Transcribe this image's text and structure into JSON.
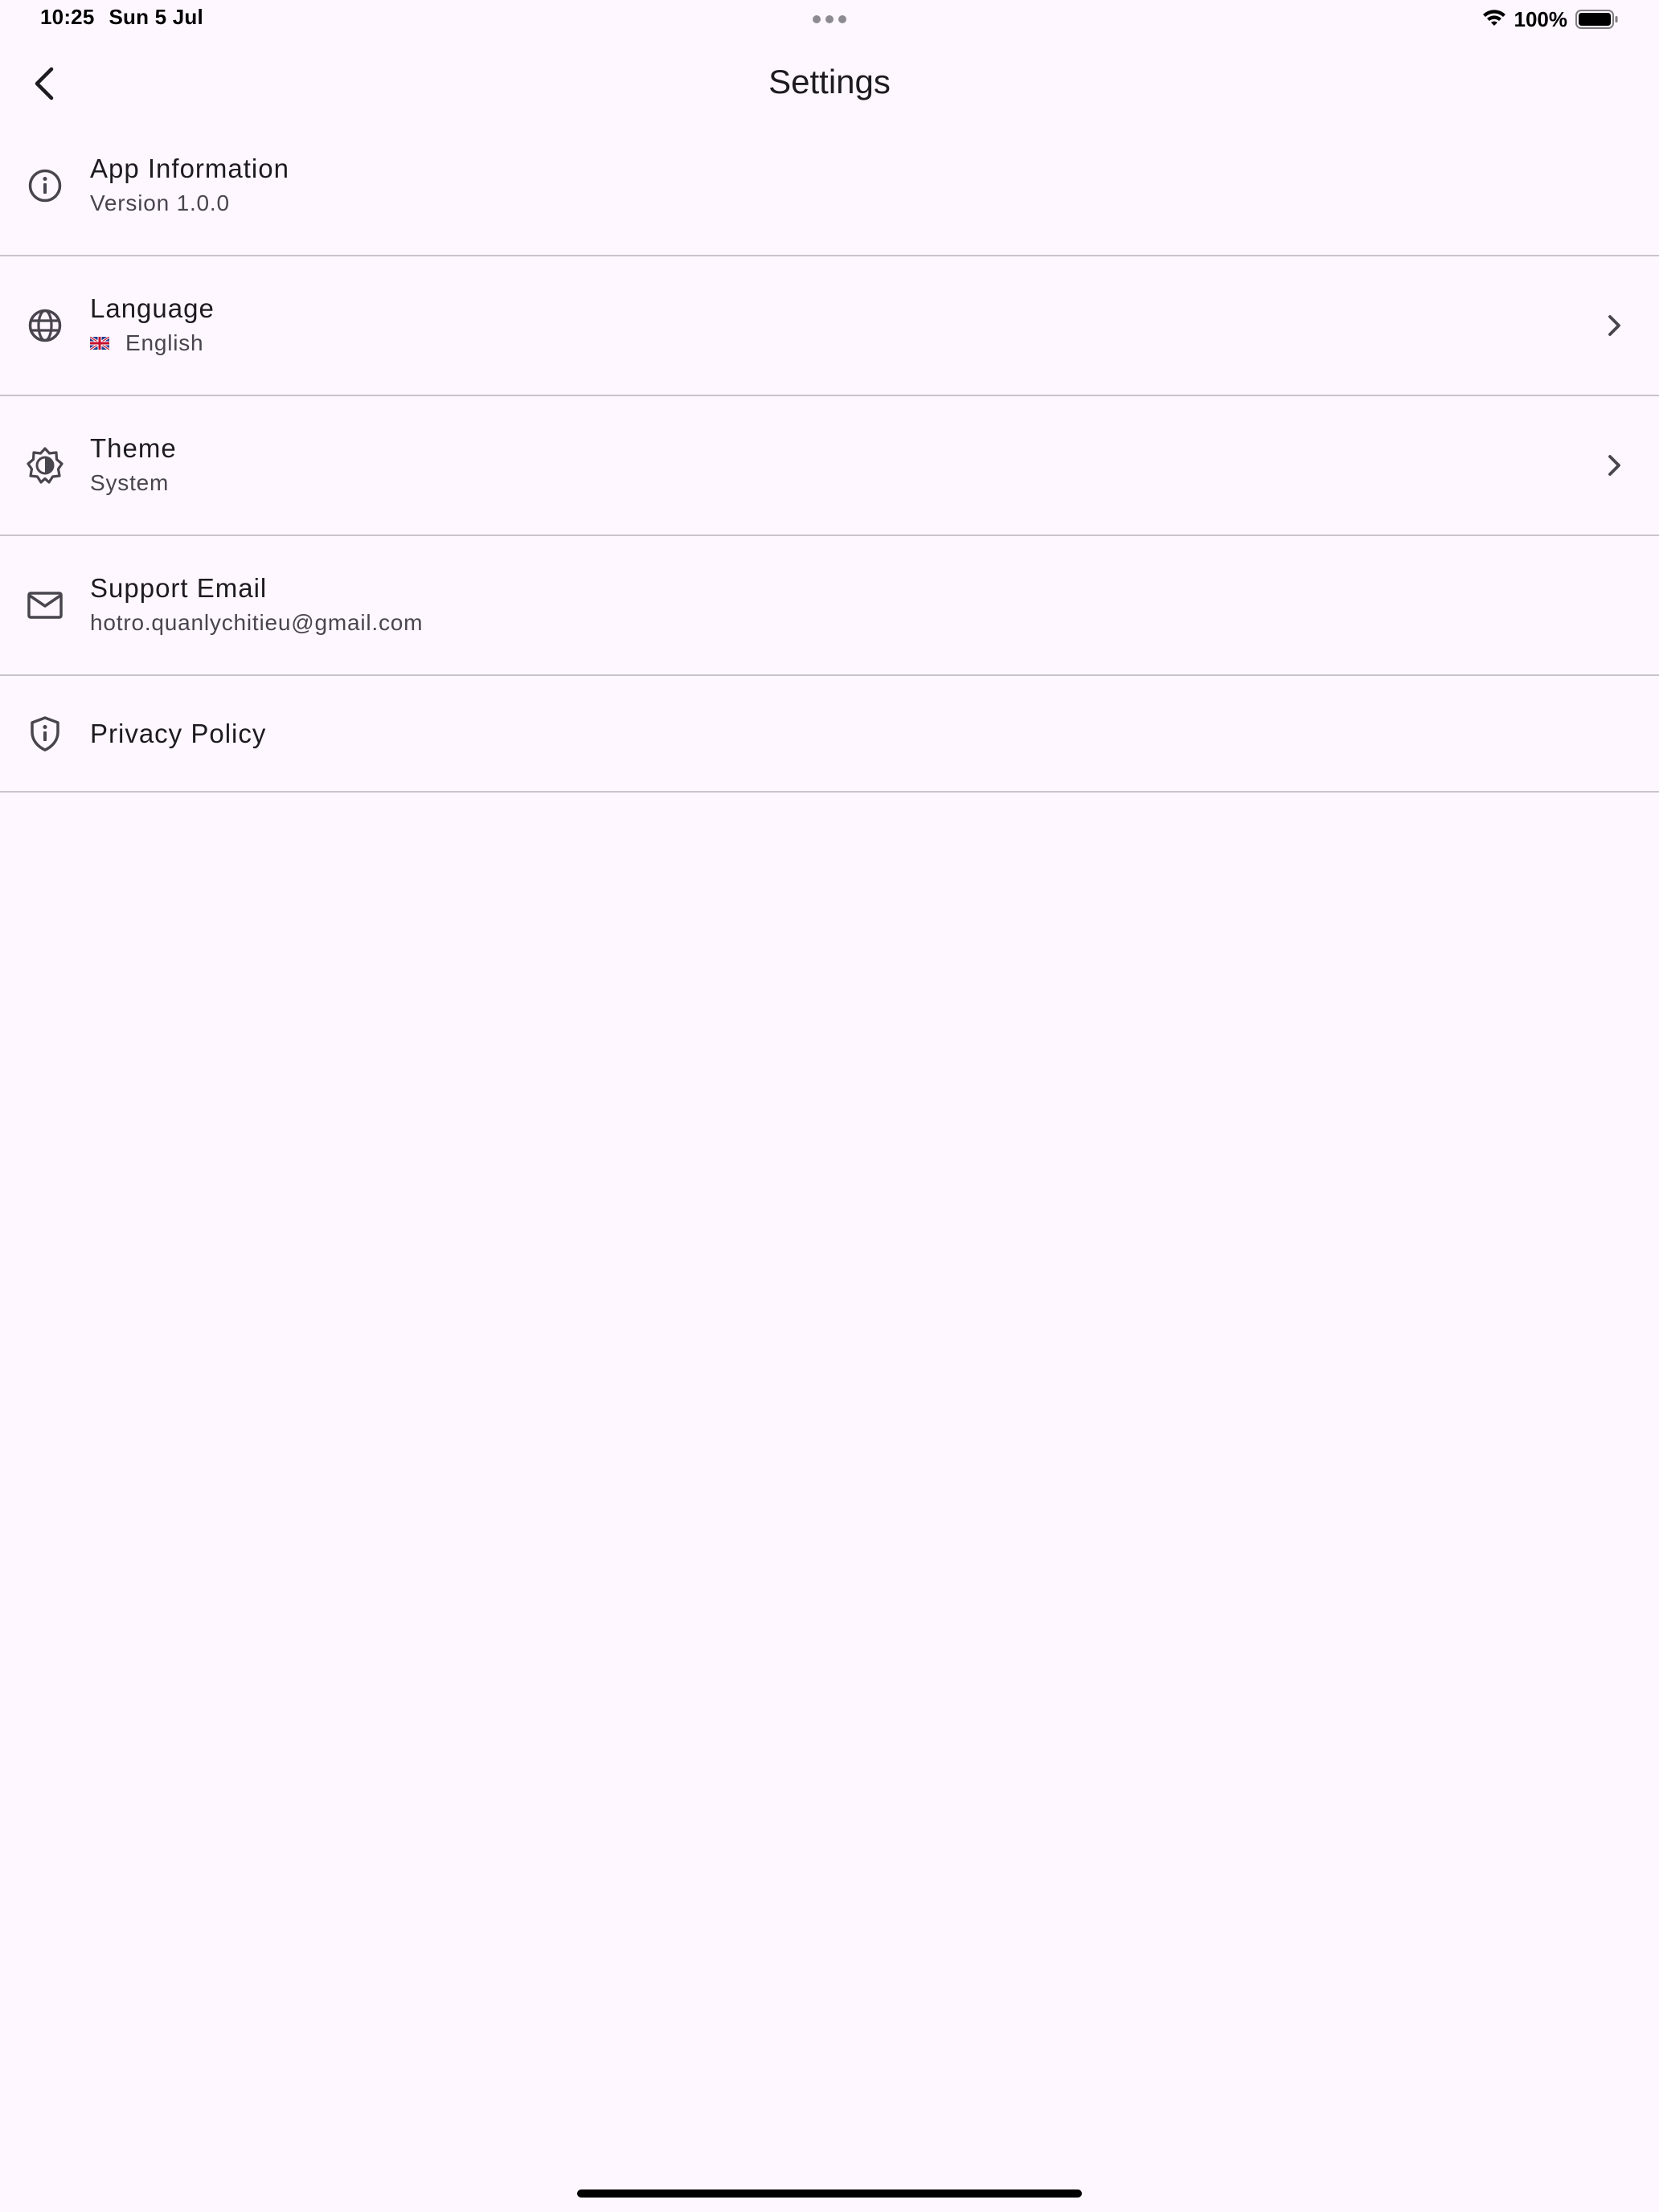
{
  "status_bar": {
    "time": "10:25",
    "date": "Sun 5 Jul",
    "battery_percent": "100%",
    "battery_level": 1.0,
    "wifi_icon": "wifi-icon",
    "battery_icon": "battery-icon"
  },
  "app_bar": {
    "title": "Settings",
    "back_icon": "chevron-left-icon"
  },
  "settings": {
    "items": [
      {
        "icon": "info-icon",
        "title": "App Information",
        "subtitle": "Version 1.0.0",
        "has_chevron": false
      },
      {
        "icon": "globe-icon",
        "title": "Language",
        "subtitle": "English",
        "flag": "uk-flag-icon",
        "has_chevron": true
      },
      {
        "icon": "brightness-icon",
        "title": "Theme",
        "subtitle": "System",
        "has_chevron": true
      },
      {
        "icon": "mail-icon",
        "title": "Support Email",
        "subtitle": "hotro.quanlychitieu@gmail.com",
        "has_chevron": false
      },
      {
        "icon": "shield-icon",
        "title": "Privacy Policy",
        "has_chevron": false
      }
    ]
  },
  "colors": {
    "background": "#fef7ff",
    "divider": "#c9c4cc",
    "icon": "#49454f",
    "text_primary": "#1d1b20",
    "text_secondary": "#49454f"
  }
}
